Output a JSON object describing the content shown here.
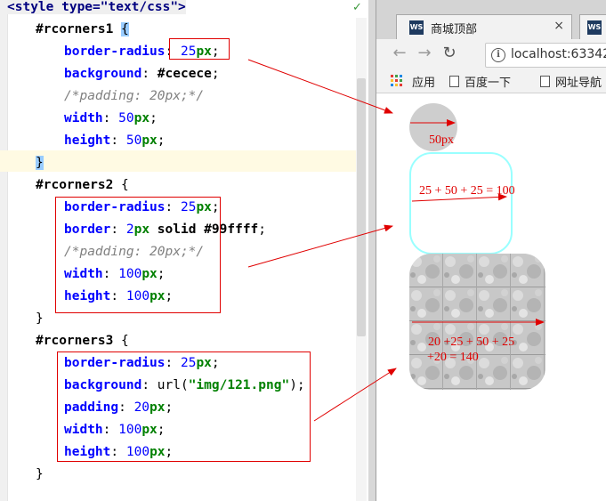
{
  "editor": {
    "lines": {
      "style_tag": "<style type=\"text/css\">",
      "sel1": "#rcorners1",
      "sel2": "#rcorners2",
      "sel3": "#rcorners3",
      "open": "{",
      "close": "}"
    },
    "rc1": {
      "border_radius_prop": "border-radius",
      "border_radius_num": "25",
      "border_radius_unit": "px",
      "background_prop": "background",
      "background_val": "#cecece",
      "padding_comment": "/*padding: 20px;*/",
      "width_prop": "width",
      "width_num": "50",
      "height_prop": "height",
      "height_num": "50"
    },
    "rc2": {
      "border_radius_prop": "border-radius",
      "border_radius_num": "25",
      "border_prop": "border",
      "border_num": "2",
      "border_rest": " solid #99ffff",
      "padding_comment": "/*padding: 20px;*/",
      "width_prop": "width",
      "width_num": "100",
      "height_prop": "height",
      "height_num": "100"
    },
    "rc3": {
      "border_radius_prop": "border-radius",
      "border_radius_num": "25",
      "background_prop": "background",
      "background_fn": "url(",
      "background_str": "\"img/121.png\"",
      "background_end": ");",
      "padding_prop": "padding",
      "padding_num": "20",
      "width_prop": "width",
      "width_num": "100",
      "height_prop": "height",
      "height_num": "100"
    },
    "px": "px",
    "colon": ": ",
    "semicolon": ";",
    "check_icon": "check-icon"
  },
  "browser": {
    "tab_title": "商城顶部",
    "tab_icon_text": "WS",
    "tab_close": "×",
    "url": "localhost:63342/",
    "bookmarks": [
      "应用",
      "百度一下",
      "网址导航"
    ],
    "annotations": {
      "circle": "50px",
      "box2": "25 + 50 + 25 = 100",
      "box3_line1": "20 +25 + 50 + 25",
      "box3_line2": "+20 = 140"
    }
  },
  "colors": {
    "annotation": "#e00000",
    "circle_bg": "#cecece",
    "border2": "#99ffff"
  }
}
